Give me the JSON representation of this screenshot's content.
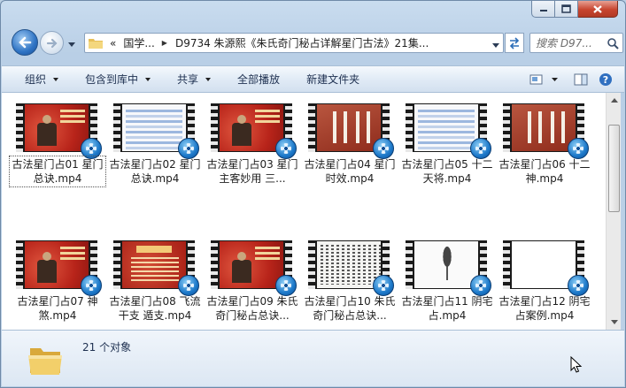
{
  "window": {
    "controls": {
      "minimize": "minimize",
      "maximize": "maximize",
      "close": "close"
    }
  },
  "address_bar": {
    "overflow": "«",
    "crumbs": [
      "国学...",
      "D9734 朱源熙《朱氏奇门秘占详解星门古法》21集..."
    ]
  },
  "search": {
    "placeholder": "搜索 D97..."
  },
  "toolbar": {
    "organize": "组织",
    "include_in_library": "包含到库中",
    "share": "共享",
    "play_all": "全部播放",
    "new_folder": "新建文件夹"
  },
  "files": [
    {
      "name": "古法星门占01 星门总诀.mp4",
      "thumb": "red"
    },
    {
      "name": "古法星门占02 星门总诀.mp4",
      "thumb": "table"
    },
    {
      "name": "古法星门占03 星门主客妙用 三...",
      "thumb": "red"
    },
    {
      "name": "古法星门占04 星门时效.mp4",
      "thumb": "calli"
    },
    {
      "name": "古法星门占05 十二天将.mp4",
      "thumb": "table"
    },
    {
      "name": "古法星门占06 十二神.mp4",
      "thumb": "calli"
    },
    {
      "name": "古法星门占07 神煞.mp4",
      "thumb": "red"
    },
    {
      "name": "古法星门占08 飞流干支 遁支.mp4",
      "thumb": "intro"
    },
    {
      "name": "古法星门占09 朱氏奇门秘占总诀...",
      "thumb": "red"
    },
    {
      "name": "古法星门占10 朱氏奇门秘占总诀...",
      "thumb": "scan"
    },
    {
      "name": "古法星门占11 阴宅占.mp4",
      "thumb": "tree"
    },
    {
      "name": "古法星门占12 阴宅占案例.mp4",
      "thumb": "blank"
    }
  ],
  "status": {
    "count": "21 个对象"
  },
  "colors": {
    "accent": "#2e73c4",
    "toolbar_text": "#1e3050"
  }
}
